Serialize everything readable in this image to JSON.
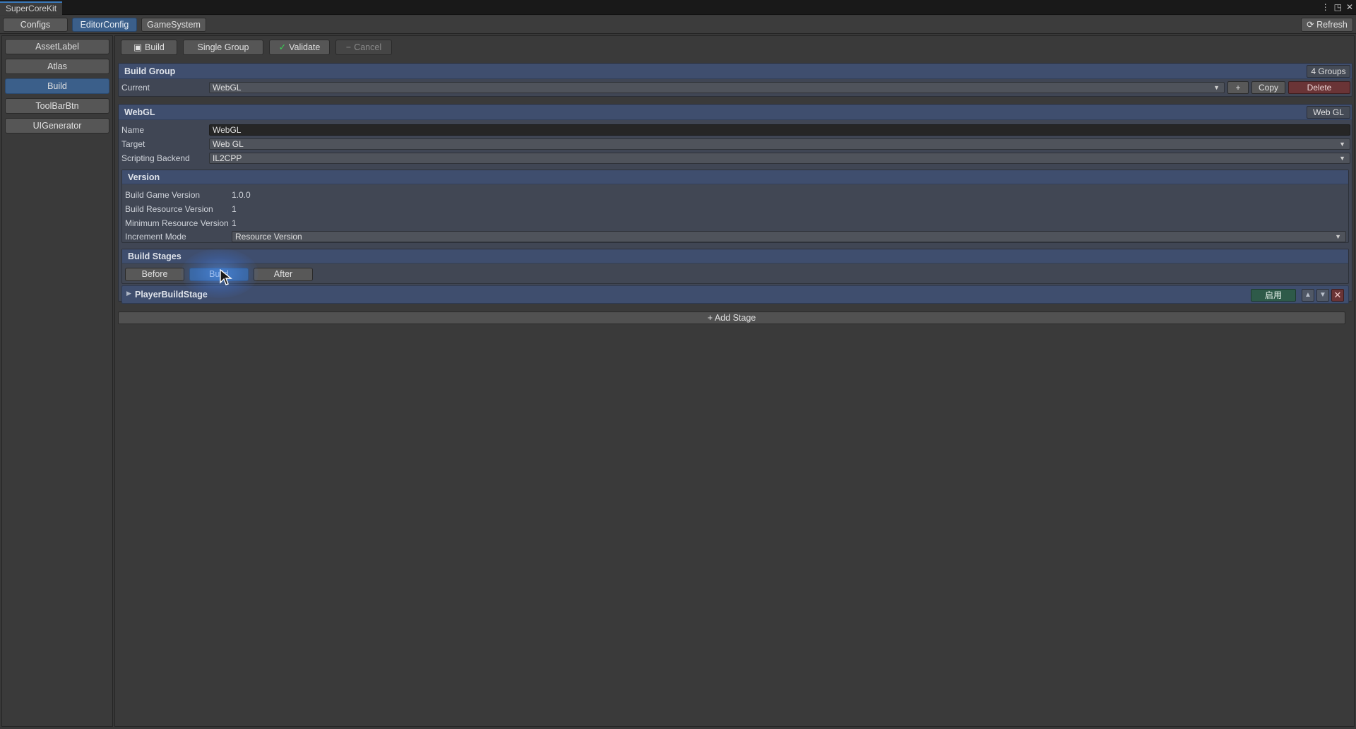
{
  "window": {
    "title": "SuperCoreKit",
    "controls": [
      "⋮",
      "◳",
      "✕"
    ]
  },
  "top_tabs": [
    {
      "label": "Configs",
      "active": false
    },
    {
      "label": "EditorConfig",
      "active": true
    },
    {
      "label": "GameSystem",
      "active": false
    }
  ],
  "refresh_label": "Refresh",
  "sidebar": {
    "items": [
      {
        "label": "AssetLabel",
        "active": false
      },
      {
        "label": "Atlas",
        "active": false
      },
      {
        "label": "Build",
        "active": true
      },
      {
        "label": "ToolBarBtn",
        "active": false
      },
      {
        "label": "UIGenerator",
        "active": false
      }
    ]
  },
  "toolbar": {
    "build": "Build",
    "single_group": "Single Group",
    "validate": "Validate",
    "cancel": "Cancel"
  },
  "build_group": {
    "title": "Build Group",
    "count_badge": "4 Groups",
    "current_label": "Current",
    "current_value": "WebGL",
    "add": "+",
    "copy": "Copy",
    "delete": "Delete"
  },
  "group": {
    "title": "WebGL",
    "badge": "Web GL",
    "name_label": "Name",
    "name_value": "WebGL",
    "target_label": "Target",
    "target_value": "Web GL",
    "backend_label": "Scripting Backend",
    "backend_value": "IL2CPP"
  },
  "version": {
    "title": "Version",
    "game_label": "Build Game Version",
    "game_value": "1.0.0",
    "resource_label": "Build Resource Version",
    "resource_value": "1",
    "min_label": "Minimum Resource Version",
    "min_value": "1",
    "mode_label": "Increment Mode",
    "mode_value": "Resource Version"
  },
  "stages": {
    "title": "Build Stages",
    "tabs": [
      {
        "label": "Before",
        "active": false
      },
      {
        "label": "Build",
        "active": true
      },
      {
        "label": "After",
        "active": false
      }
    ],
    "item_name": "PlayerBuildStage",
    "enable_label": "启用",
    "add_label": "+ Add Stage"
  },
  "colors": {
    "accent": "#3b5f8a",
    "section_header": "#3f4e6e",
    "enable_green": "#2e5a49",
    "delete_red": "#6a3436",
    "validate_check": "#39d353"
  }
}
